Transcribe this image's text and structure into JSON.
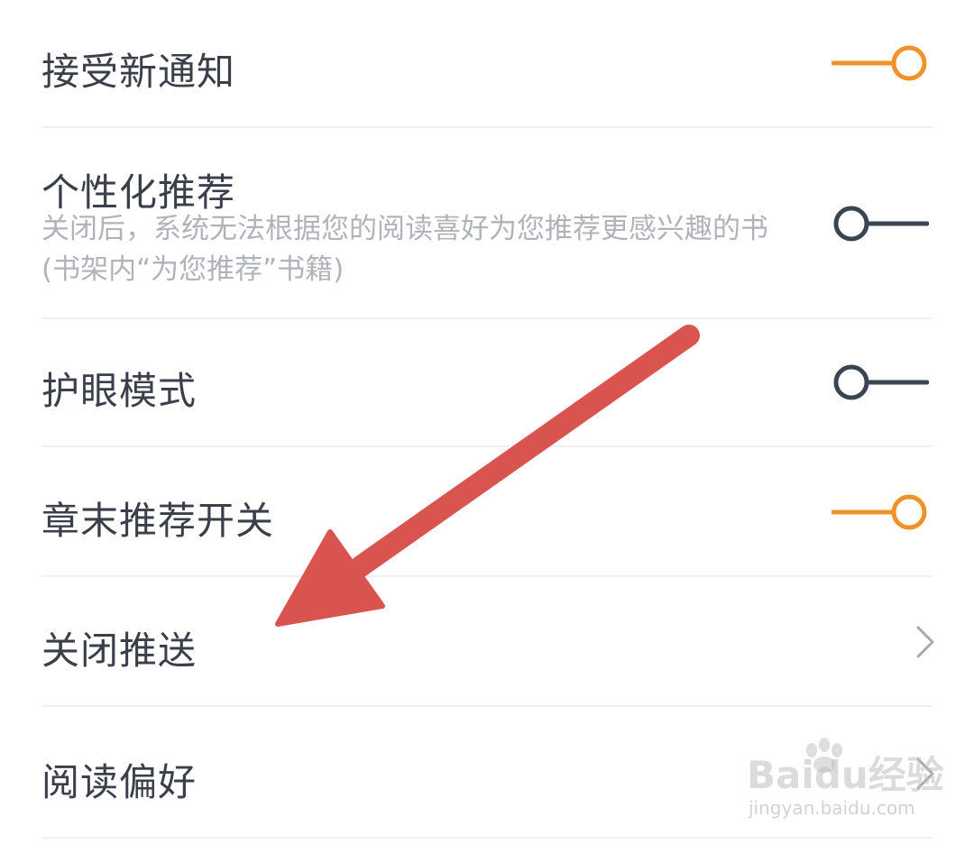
{
  "settings": {
    "items": [
      {
        "label": "接受新通知",
        "control": "toggle",
        "on": true
      },
      {
        "label": "个性化推荐",
        "description": "关闭后，系统无法根据您的阅读喜好为您推荐更感兴趣的书(书架内“为您推荐”书籍)",
        "control": "toggle",
        "on": false
      },
      {
        "label": "护眼模式",
        "control": "toggle",
        "on": false
      },
      {
        "label": "章末推荐开关",
        "control": "toggle",
        "on": true
      },
      {
        "label": "关闭推送",
        "control": "chevron"
      },
      {
        "label": "阅读偏好",
        "control": "chevron"
      }
    ]
  },
  "colors": {
    "toggle_on": "#f0922b",
    "toggle_off": "#3a4452",
    "annotation_arrow": "#d9534f"
  },
  "watermark": {
    "main": "Baidu经验",
    "sub": "jingyan.baidu.com"
  },
  "icons": {
    "toggle": "toggle-switch-icon",
    "chevron": "chevron-right-icon",
    "arrow": "annotation-arrow"
  }
}
